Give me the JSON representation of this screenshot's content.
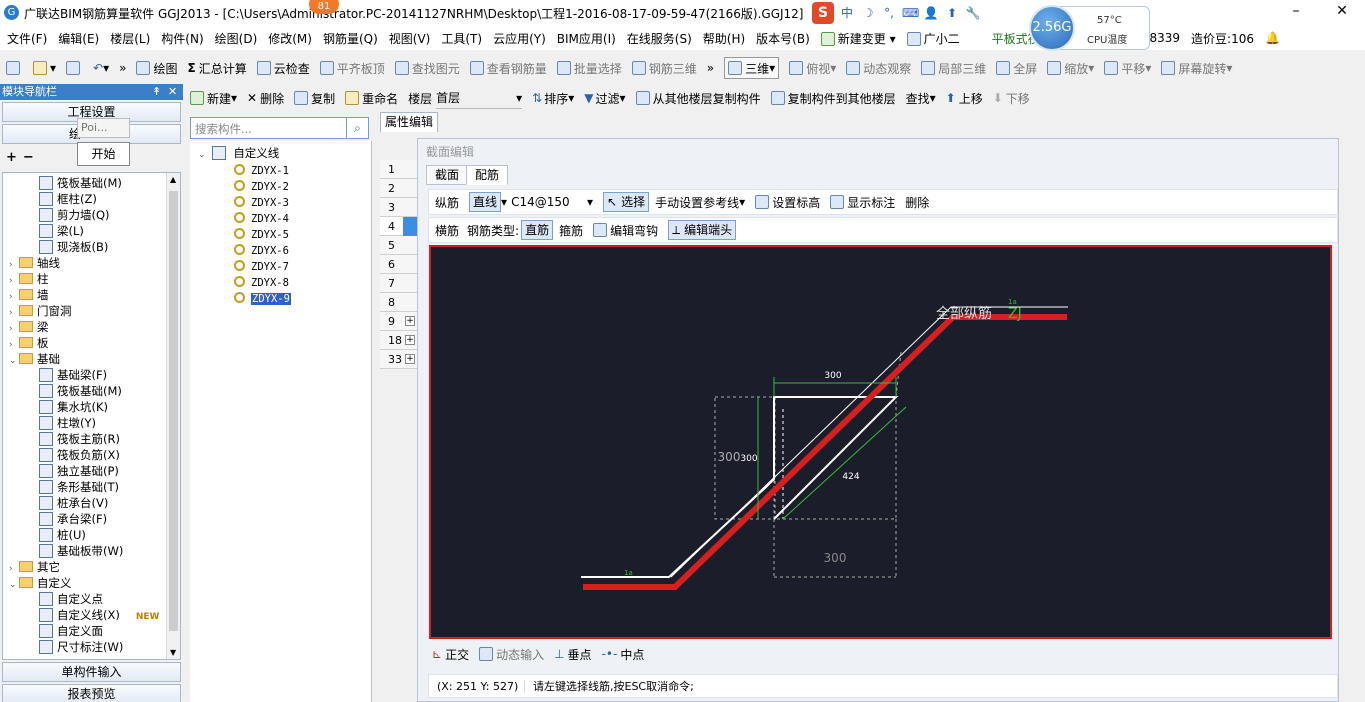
{
  "window": {
    "title": "广联达BIM钢筋算量软件 GGJ2013 - [C:\\Users\\Administrator.PC-20141127NRHM\\Desktop\\工程1-2016-08-17-09-59-47(2166版).GGJ12]",
    "notification_count": "81",
    "min": "–",
    "restore": "❐",
    "close": "✕"
  },
  "ime": {
    "logo": "S",
    "mode": "中",
    "items": [
      "☽",
      "°,",
      "⌨",
      "👤",
      "⬆",
      "🔧"
    ]
  },
  "cpu": {
    "usage": "2.56G",
    "temp": "57°C",
    "label": "CPU温度"
  },
  "menu": [
    "文件(F)",
    "编辑(E)",
    "楼层(L)",
    "构件(N)",
    "绘图(D)",
    "修改(M)",
    "钢筋量(Q)",
    "视图(V)",
    "工具(T)",
    "云应用(Y)",
    "BIM应用(I)",
    "在线服务(S)",
    "帮助(H)",
    "版本号(B)",
    "新建变更",
    "广小二",
    "平板式筏板基",
    "3907298339",
    "造价豆:106"
  ],
  "toolbar1": {
    "draw": "绘图",
    "sum_label": "汇总计算",
    "cloud_check": "云检查",
    "flat_top": "平齐板顶",
    "find_elem": "查找图元",
    "view_rebar": "查看钢筋量",
    "batch_select": "批量选择",
    "rebar_3d": "钢筋三维",
    "view_mode": "三维",
    "top_view": "俯视",
    "dyn_view": "动态观察",
    "local_3d": "局部三维",
    "fullscreen": "全屏",
    "zoom": "缩放",
    "pan": "平移",
    "rotate": "屏幕旋转"
  },
  "toolbar2": {
    "new": "新建",
    "delete": "删除",
    "copy": "复制",
    "rename": "重命名",
    "floor_label": "楼层",
    "floor_value": "首层",
    "sort": "排序",
    "filter": "过滤",
    "copy_from": "从其他楼层复制构件",
    "copy_to": "复制构件到其他楼层",
    "find": "查找",
    "move_up": "上移",
    "move_down": "下移"
  },
  "nav": {
    "title": "模块导航栏",
    "pin": "↟",
    "close": "✕",
    "project_settings": "工程设置",
    "draw_input": "绘",
    "popup_text": "Poi...",
    "start_button": "开始",
    "single_input": "单构件输入",
    "report": "报表预览"
  },
  "tree": [
    {
      "label": "筏板基础(M)",
      "level": 2
    },
    {
      "label": "框柱(Z)",
      "level": 2
    },
    {
      "label": "剪力墙(Q)",
      "level": 2
    },
    {
      "label": "梁(L)",
      "level": 2
    },
    {
      "label": "现浇板(B)",
      "level": 2
    },
    {
      "label": "轴线",
      "level": 1,
      "exp": "›"
    },
    {
      "label": "柱",
      "level": 1,
      "exp": "›"
    },
    {
      "label": "墙",
      "level": 1,
      "exp": "›"
    },
    {
      "label": "门窗洞",
      "level": 1,
      "exp": "›"
    },
    {
      "label": "梁",
      "level": 1,
      "exp": "›"
    },
    {
      "label": "板",
      "level": 1,
      "exp": "›"
    },
    {
      "label": "基础",
      "level": 1,
      "exp": "⌄"
    },
    {
      "label": "基础梁(F)",
      "level": 2
    },
    {
      "label": "筏板基础(M)",
      "level": 2
    },
    {
      "label": "集水坑(K)",
      "level": 2
    },
    {
      "label": "柱墩(Y)",
      "level": 2
    },
    {
      "label": "筏板主筋(R)",
      "level": 2
    },
    {
      "label": "筏板负筋(X)",
      "level": 2
    },
    {
      "label": "独立基础(P)",
      "level": 2
    },
    {
      "label": "条形基础(T)",
      "level": 2
    },
    {
      "label": "桩承台(V)",
      "level": 2
    },
    {
      "label": "承台梁(F)",
      "level": 2
    },
    {
      "label": "桩(U)",
      "level": 2
    },
    {
      "label": "基础板带(W)",
      "level": 2
    },
    {
      "label": "其它",
      "level": 1,
      "exp": "›"
    },
    {
      "label": "自定义",
      "level": 1,
      "exp": "⌄"
    },
    {
      "label": "自定义点",
      "level": 2
    },
    {
      "label": "自定义线(X)",
      "level": 2,
      "badge": "NEW"
    },
    {
      "label": "自定义面",
      "level": 2
    },
    {
      "label": "尺寸标注(W)",
      "level": 2
    }
  ],
  "search": {
    "placeholder": "搜索构件..."
  },
  "components": {
    "root": "自定义线",
    "items": [
      "ZDYX-1",
      "ZDYX-2",
      "ZDYX-3",
      "ZDYX-4",
      "ZDYX-5",
      "ZDYX-6",
      "ZDYX-7",
      "ZDYX-8",
      "ZDYX-9"
    ],
    "selected": "ZDYX-9"
  },
  "prop": {
    "tab": "属性编辑",
    "rows": [
      {
        "n": "1"
      },
      {
        "n": "2"
      },
      {
        "n": "3"
      },
      {
        "n": "4",
        "cur": true
      },
      {
        "n": "5"
      },
      {
        "n": "6"
      },
      {
        "n": "7"
      },
      {
        "n": "8"
      },
      {
        "n": "9",
        "plus": true
      },
      {
        "n": "18",
        "plus": true
      },
      {
        "n": "33",
        "plus": true
      }
    ]
  },
  "dialog": {
    "title": "截面编辑",
    "tab_section": "截面",
    "tab_rebar": "配筋",
    "long_bar": "纵筋",
    "line": "直线",
    "spec": "C14@150",
    "select": "选择",
    "manual_ref": "手动设置参考线",
    "set_elev": "设置标高",
    "show_dim": "显示标注",
    "delete": "删除",
    "trans_bar": "横筋",
    "bar_type_label": "钢筋类型:",
    "straight": "直筋",
    "stirrup": "箍筋",
    "edit_bend": "编辑弯钩",
    "edit_end": "编辑端头",
    "ortho": "正交",
    "dyn_input": "动态输入",
    "perp": "垂点",
    "mid": "中点",
    "coords": "(X: 251 Y: 527)",
    "prompt": "请左键选择线筋,按ESC取消命令;"
  },
  "drawing": {
    "label_main": "全部纵筋",
    "label_zj": "ZJ",
    "dim_top": "300",
    "dim_left_outer": "300",
    "dim_left_inner": "300",
    "dim_diag": "424",
    "dim_bottom": "300",
    "small_label_a": "1a",
    "small_label_b": "1a"
  }
}
